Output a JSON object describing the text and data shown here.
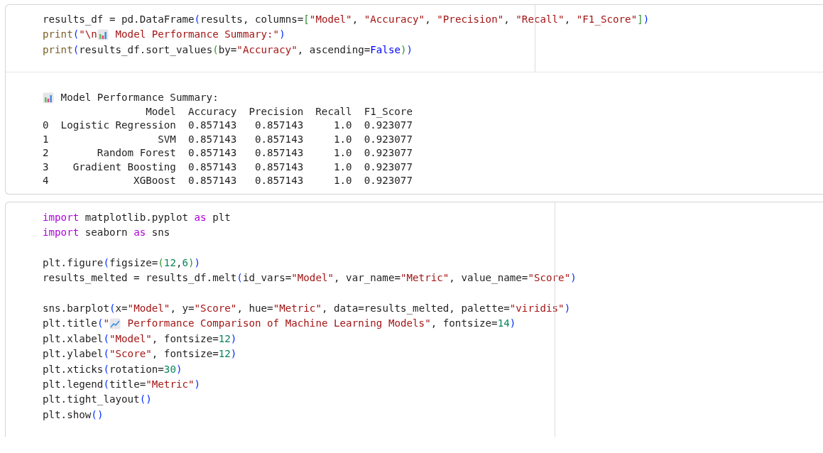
{
  "cells": [
    {
      "code": [
        [
          [
            {
              "text": "results_df = pd.DataFrame",
              "kind": "plain"
            },
            {
              "text": "(",
              "kind": "paren1"
            },
            {
              "text": "results, columns=",
              "kind": "plain"
            },
            {
              "text": "[",
              "kind": "paren2"
            },
            {
              "text": "\"Model\"",
              "kind": "str"
            },
            {
              "text": ", ",
              "kind": "plain"
            },
            {
              "text": "\"Accuracy\"",
              "kind": "str"
            },
            {
              "text": ", ",
              "kind": "plain"
            },
            {
              "text": "\"Precision\"",
              "kind": "str"
            },
            {
              "text": ", ",
              "kind": "plain"
            },
            {
              "text": "\"Recall\"",
              "kind": "str"
            },
            {
              "text": ", ",
              "kind": "plain"
            },
            {
              "text": "\"F1_Score\"",
              "kind": "str"
            },
            {
              "text": "]",
              "kind": "paren2"
            },
            {
              "text": ")",
              "kind": "paren1"
            }
          ],
          [
            {
              "text": "print",
              "kind": "fn"
            },
            {
              "text": "(",
              "kind": "paren1"
            },
            {
              "text": "\"\\n",
              "kind": "str"
            },
            {
              "kind": "icon_bars"
            },
            {
              "text": " Model Performance Summary:\"",
              "kind": "str"
            },
            {
              "text": ")",
              "kind": "paren1"
            }
          ],
          [
            {
              "text": "print",
              "kind": "fn"
            },
            {
              "text": "(",
              "kind": "paren1"
            },
            {
              "text": "results_df.sort_values",
              "kind": "plain"
            },
            {
              "text": "(",
              "kind": "paren2"
            },
            {
              "text": "by=",
              "kind": "plain"
            },
            {
              "text": "\"Accuracy\"",
              "kind": "str"
            },
            {
              "text": ", ascending=",
              "kind": "plain"
            },
            {
              "text": "False",
              "kind": "const"
            },
            {
              "text": ")",
              "kind": "paren2"
            },
            {
              "text": ")",
              "kind": "paren1"
            }
          ]
        ]
      ],
      "output": {
        "title": "Model Performance Summary:",
        "columns": [
          "",
          "Model",
          "Accuracy",
          "Precision",
          "Recall",
          "F1_Score"
        ],
        "rows": [
          [
            "0",
            "Logistic Regression",
            "0.857143",
            "0.857143",
            "1.0",
            "0.923077"
          ],
          [
            "1",
            "SVM",
            "0.857143",
            "0.857143",
            "1.0",
            "0.923077"
          ],
          [
            "2",
            "Random Forest",
            "0.857143",
            "0.857143",
            "1.0",
            "0.923077"
          ],
          [
            "3",
            "Gradient Boosting",
            "0.857143",
            "0.857143",
            "1.0",
            "0.923077"
          ],
          [
            "4",
            "XGBoost",
            "0.857143",
            "0.857143",
            "1.0",
            "0.923077"
          ]
        ]
      }
    },
    {
      "code": [
        [
          [
            {
              "text": "import",
              "kind": "kw"
            },
            {
              "text": " matplotlib.pyplot ",
              "kind": "plain"
            },
            {
              "text": "as",
              "kind": "kw"
            },
            {
              "text": " plt",
              "kind": "plain"
            }
          ],
          [
            {
              "text": "import",
              "kind": "kw"
            },
            {
              "text": " seaborn ",
              "kind": "plain"
            },
            {
              "text": "as",
              "kind": "kw"
            },
            {
              "text": " sns",
              "kind": "plain"
            }
          ]
        ],
        [
          [
            {
              "text": "plt.figure",
              "kind": "plain"
            },
            {
              "text": "(",
              "kind": "paren1"
            },
            {
              "text": "figsize=",
              "kind": "plain"
            },
            {
              "text": "(",
              "kind": "paren2"
            },
            {
              "text": "12",
              "kind": "num"
            },
            {
              "text": ",",
              "kind": "plain"
            },
            {
              "text": "6",
              "kind": "num"
            },
            {
              "text": ")",
              "kind": "paren2"
            },
            {
              "text": ")",
              "kind": "paren1"
            }
          ],
          [
            {
              "text": "results_melted = results_df.melt",
              "kind": "plain"
            },
            {
              "text": "(",
              "kind": "paren1"
            },
            {
              "text": "id_vars=",
              "kind": "plain"
            },
            {
              "text": "\"Model\"",
              "kind": "str"
            },
            {
              "text": ", var_name=",
              "kind": "plain"
            },
            {
              "text": "\"Metric\"",
              "kind": "str"
            },
            {
              "text": ", value_name=",
              "kind": "plain"
            },
            {
              "text": "\"Score\"",
              "kind": "str"
            },
            {
              "text": ")",
              "kind": "paren1"
            }
          ]
        ],
        [
          [
            {
              "text": "sns.barplot",
              "kind": "plain"
            },
            {
              "text": "(",
              "kind": "paren1"
            },
            {
              "text": "x=",
              "kind": "plain"
            },
            {
              "text": "\"Model\"",
              "kind": "str"
            },
            {
              "text": ", y=",
              "kind": "plain"
            },
            {
              "text": "\"Score\"",
              "kind": "str"
            },
            {
              "text": ", hue=",
              "kind": "plain"
            },
            {
              "text": "\"Metric\"",
              "kind": "str"
            },
            {
              "text": ", data=results_melted, palette=",
              "kind": "plain"
            },
            {
              "text": "\"viridis\"",
              "kind": "str"
            },
            {
              "text": ")",
              "kind": "paren1"
            }
          ],
          [
            {
              "text": "plt.title",
              "kind": "plain"
            },
            {
              "text": "(",
              "kind": "paren1"
            },
            {
              "text": "\"",
              "kind": "str"
            },
            {
              "kind": "icon_line"
            },
            {
              "text": " Performance Comparison of Machine Learning Models\"",
              "kind": "str"
            },
            {
              "text": ", fontsize=",
              "kind": "plain"
            },
            {
              "text": "14",
              "kind": "num"
            },
            {
              "text": ")",
              "kind": "paren1"
            }
          ],
          [
            {
              "text": "plt.xlabel",
              "kind": "plain"
            },
            {
              "text": "(",
              "kind": "paren1"
            },
            {
              "text": "\"Model\"",
              "kind": "str"
            },
            {
              "text": ", fontsize=",
              "kind": "plain"
            },
            {
              "text": "12",
              "kind": "num"
            },
            {
              "text": ")",
              "kind": "paren1"
            }
          ],
          [
            {
              "text": "plt.ylabel",
              "kind": "plain"
            },
            {
              "text": "(",
              "kind": "paren1"
            },
            {
              "text": "\"Score\"",
              "kind": "str"
            },
            {
              "text": ", fontsize=",
              "kind": "plain"
            },
            {
              "text": "12",
              "kind": "num"
            },
            {
              "text": ")",
              "kind": "paren1"
            }
          ],
          [
            {
              "text": "plt.xticks",
              "kind": "plain"
            },
            {
              "text": "(",
              "kind": "paren1"
            },
            {
              "text": "rotation=",
              "kind": "plain"
            },
            {
              "text": "30",
              "kind": "num"
            },
            {
              "text": ")",
              "kind": "paren1"
            }
          ],
          [
            {
              "text": "plt.legend",
              "kind": "plain"
            },
            {
              "text": "(",
              "kind": "paren1"
            },
            {
              "text": "title=",
              "kind": "plain"
            },
            {
              "text": "\"Metric\"",
              "kind": "str"
            },
            {
              "text": ")",
              "kind": "paren1"
            }
          ],
          [
            {
              "text": "plt.tight_layout",
              "kind": "plain"
            },
            {
              "text": "()",
              "kind": "paren1"
            }
          ],
          [
            {
              "text": "plt.show",
              "kind": "plain"
            },
            {
              "text": "()",
              "kind": "paren1"
            }
          ]
        ]
      ]
    }
  ]
}
